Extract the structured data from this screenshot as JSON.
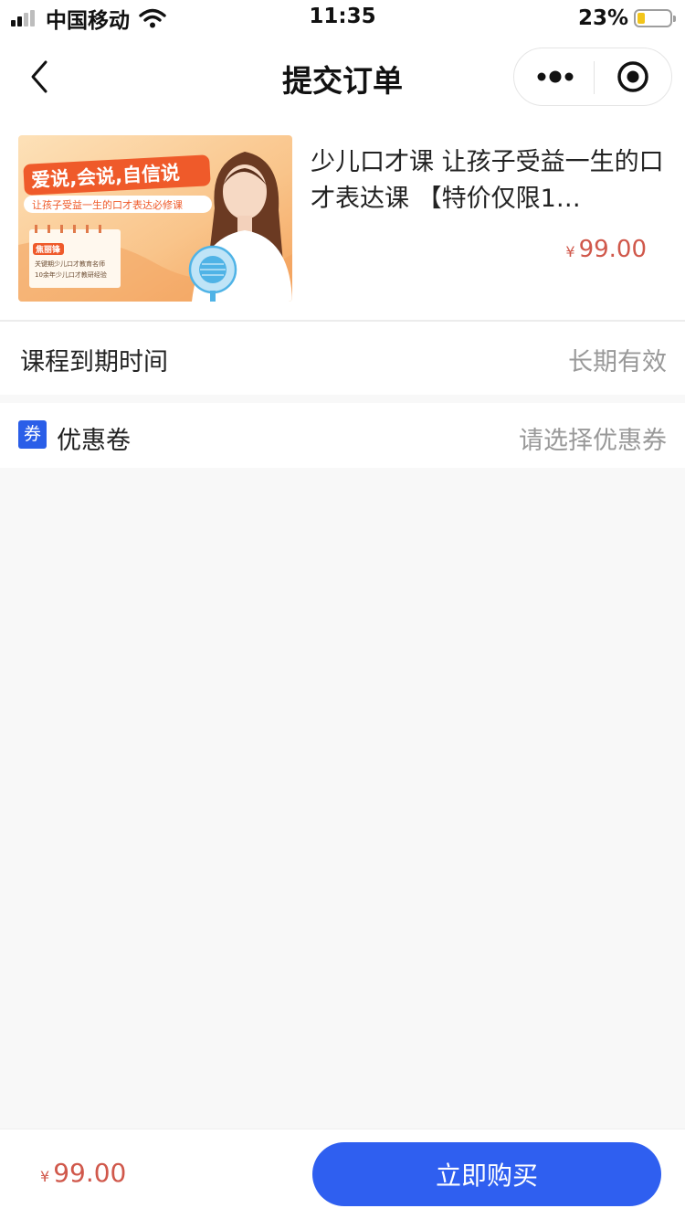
{
  "status_bar": {
    "carrier": "中国移动",
    "time": "11:35",
    "battery": "23%",
    "battery_level": 0.23,
    "icons": [
      "signal-icon",
      "wifi-icon",
      "battery-icon"
    ]
  },
  "nav": {
    "title": "提交订单",
    "icons": [
      "chevron-left-icon",
      "more-dots-icon",
      "close-target-icon"
    ]
  },
  "product": {
    "thumbnail": {
      "headline": "爱说,会说,自信说",
      "subtitle": "让孩子受益一生的口才表达必修课",
      "badge": "焦丽锋",
      "points": [
        "关键期少儿口才教育名师",
        "10余年少儿口才教研经验"
      ]
    },
    "title": "少儿口才课 让孩子受益一生的口才表达课 【特价仅限1…",
    "currency": "¥",
    "price": "99.00"
  },
  "expiry": {
    "label": "课程到期时间",
    "value": "长期有效"
  },
  "coupon": {
    "icon_text": "券",
    "label": "优惠卷",
    "value": "请选择优惠券"
  },
  "footer": {
    "currency": "¥",
    "total": "99.00",
    "buy_label": "立即购买"
  },
  "colors": {
    "accent": "#2f5ff0",
    "price": "#d0584b",
    "coupon_badge": "#2a5ee8",
    "background": "#f8f8f8"
  }
}
